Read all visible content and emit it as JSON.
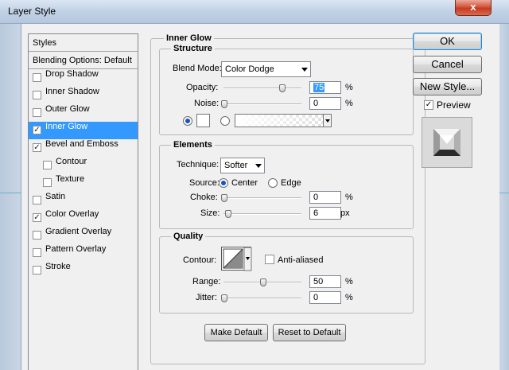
{
  "window": {
    "title": "Layer Style",
    "close_glyph": "x"
  },
  "sidebar": {
    "header": "Styles",
    "blending": "Blending Options: Default",
    "items": [
      {
        "label": "Drop Shadow",
        "checked": false
      },
      {
        "label": "Inner Shadow",
        "checked": false
      },
      {
        "label": "Outer Glow",
        "checked": false
      },
      {
        "label": "Inner Glow",
        "checked": true,
        "selected": true
      },
      {
        "label": "Bevel and Emboss",
        "checked": true
      },
      {
        "label": "Contour",
        "checked": false,
        "indent": true
      },
      {
        "label": "Texture",
        "checked": false,
        "indent": true
      },
      {
        "label": "Satin",
        "checked": false
      },
      {
        "label": "Color Overlay",
        "checked": true
      },
      {
        "label": "Gradient Overlay",
        "checked": false
      },
      {
        "label": "Pattern Overlay",
        "checked": false
      },
      {
        "label": "Stroke",
        "checked": false
      }
    ]
  },
  "panel": {
    "title": "Inner Glow",
    "structure": {
      "title": "Structure",
      "blend_mode_label": "Blend Mode:",
      "blend_mode_value": "Color Dodge",
      "opacity_label": "Opacity:",
      "opacity_value": "75",
      "opacity_unit": "%",
      "opacity_fraction": 0.75,
      "noise_label": "Noise:",
      "noise_value": "0",
      "noise_unit": "%",
      "color_swatch": "#ffffff",
      "color_mode": "solid"
    },
    "elements": {
      "title": "Elements",
      "technique_label": "Technique:",
      "technique_value": "Softer",
      "source_label": "Source:",
      "source_center": "Center",
      "source_edge": "Edge",
      "source_selected": "Center",
      "choke_label": "Choke:",
      "choke_value": "0",
      "choke_unit": "%",
      "size_label": "Size:",
      "size_value": "6",
      "size_unit": "px"
    },
    "quality": {
      "title": "Quality",
      "contour_label": "Contour:",
      "anti_aliased_label": "Anti-aliased",
      "anti_aliased": false,
      "range_label": "Range:",
      "range_value": "50",
      "range_unit": "%",
      "jitter_label": "Jitter:",
      "jitter_value": "0",
      "jitter_unit": "%"
    },
    "make_default": "Make Default",
    "reset_default": "Reset to Default"
  },
  "actions": {
    "ok": "OK",
    "cancel": "Cancel",
    "new_style": "New Style...",
    "preview_label": "Preview",
    "preview_checked": true
  },
  "colors": {
    "selection": "#3399ff",
    "dialog_bg": "#f0f0f0",
    "close_button": "#c53a22"
  }
}
